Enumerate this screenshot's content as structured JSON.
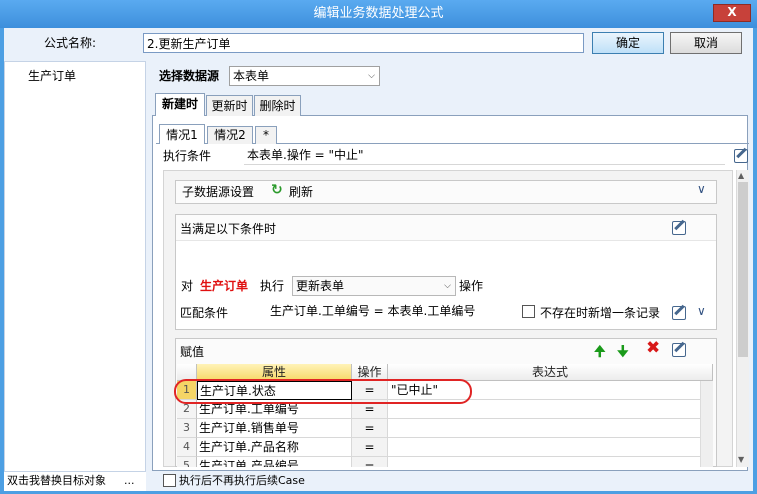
{
  "window": {
    "title": "编辑业务数据处理公式",
    "close_label": "X"
  },
  "formula": {
    "label": "公式名称:",
    "value": "2.更新生产订单"
  },
  "buttons": {
    "ok": "确定",
    "cancel": "取消"
  },
  "left_panel": {
    "items": [
      "生产订单"
    ],
    "bottom_text": "双击我替换目标对象",
    "bottom_button": "..."
  },
  "datasource": {
    "label": "选择数据源",
    "selected": "本表单"
  },
  "tabs": [
    "新建时",
    "更新时",
    "删除时"
  ],
  "case_tabs": [
    "情况1",
    "情况2",
    "*"
  ],
  "condition": {
    "label": "执行条件",
    "value": "本表单.操作 = \"中止\""
  },
  "sub_datasource": {
    "label": "子数据源设置",
    "refresh_label": "刷新"
  },
  "when_section": {
    "label": "当满足以下条件时",
    "for_label": "对",
    "target": "生产订单",
    "exec_label": "执行",
    "exec_selected": "更新表单",
    "op_label": "操作",
    "match_label": "匹配条件",
    "match_value": "生产订单.工单编号 = 本表单.工单编号",
    "new_record_label": "不存在时新增一条记录"
  },
  "assign": {
    "label": "赋值",
    "columns": [
      "属性",
      "操作",
      "表达式"
    ],
    "rows": [
      {
        "num": "1",
        "attr": "生产订单.状态",
        "op": "=",
        "expr": "\"已中止\""
      },
      {
        "num": "2",
        "attr": "生产订单.工单编号",
        "op": "=",
        "expr": ""
      },
      {
        "num": "3",
        "attr": "生产订单.销售单号",
        "op": "=",
        "expr": ""
      },
      {
        "num": "4",
        "attr": "生产订单.产品名称",
        "op": "=",
        "expr": ""
      },
      {
        "num": "5",
        "attr": "生产订单.产品编号",
        "op": "=",
        "expr": ""
      }
    ]
  },
  "bottom": {
    "checkbox_label": "执行后不再执行后续Case"
  },
  "colors": {
    "title_bar": "#4d9fe3",
    "highlight": "#e02424",
    "target": "#e01010"
  }
}
